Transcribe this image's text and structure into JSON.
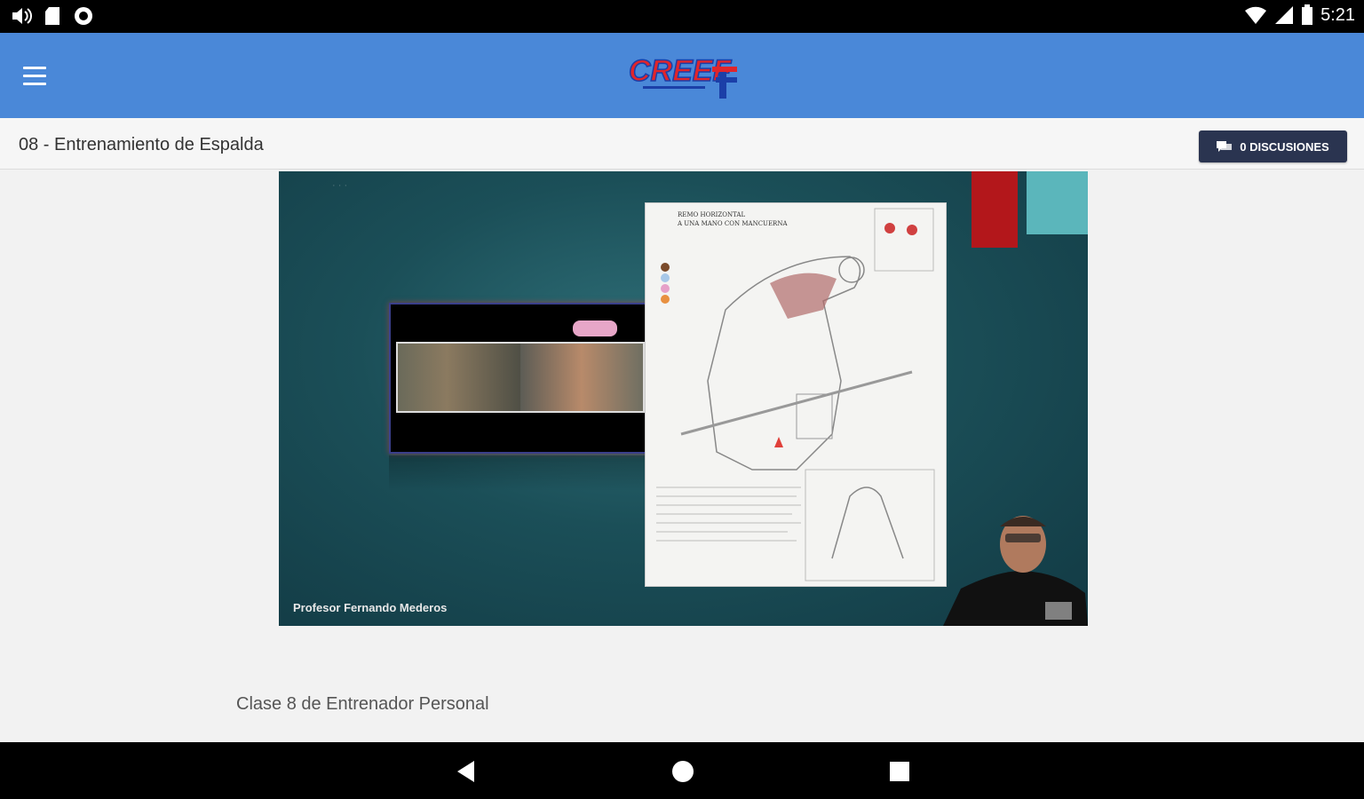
{
  "status_bar": {
    "time": "5:21",
    "left_icons": [
      "volume-icon",
      "sd-card-icon",
      "sync-icon"
    ],
    "right_icons": [
      "wifi-icon",
      "signal-icon",
      "battery-icon"
    ]
  },
  "app_bar": {
    "logo_text": "CREEF",
    "logo_colors": {
      "red": "#e0252b",
      "blue": "#1b3fa8"
    },
    "background": "#4a88d8"
  },
  "lesson": {
    "title": "08 - Entrenamiento de Espalda",
    "discussions_button": "0 DISCUSIONES",
    "description": "Clase 8 de Entrenador Personal"
  },
  "video": {
    "caption": "Profesor Fernando Mederos",
    "sheet_heading": [
      "REMO HORIZONTAL",
      "A UNA MANO CON MANCUERNA"
    ]
  },
  "nav_bar": {
    "buttons": [
      "back-icon",
      "home-icon",
      "recents-icon"
    ]
  }
}
